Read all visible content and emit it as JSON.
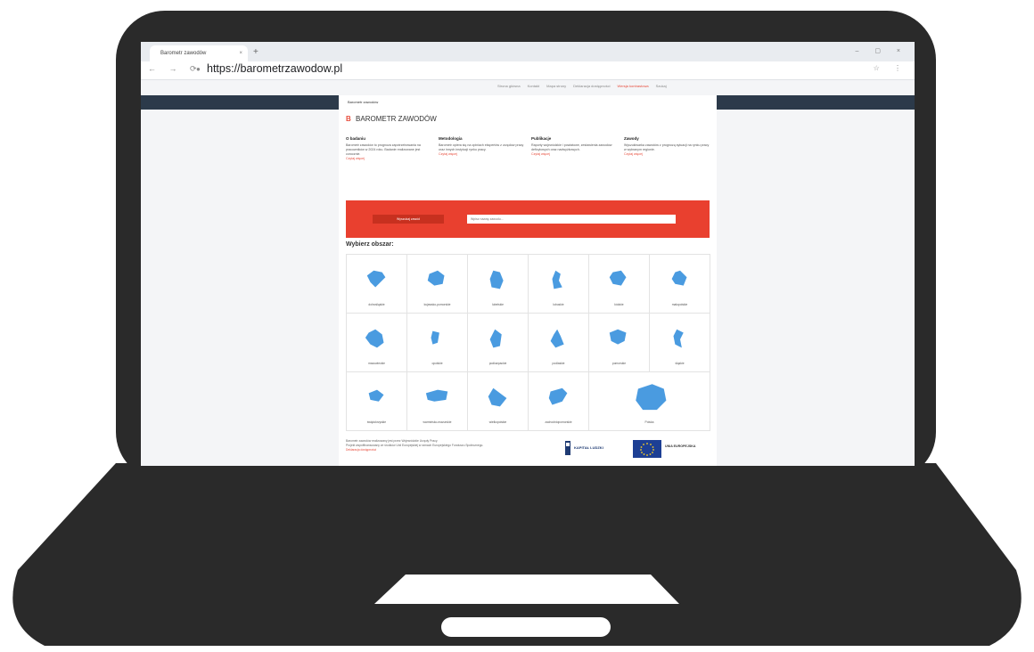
{
  "browser": {
    "tab_title": "Barometr zawodów",
    "tab_close": "×",
    "new_tab": "+",
    "window_controls": "– ▢ ×",
    "nav_buttons": "← → ⟳",
    "url": "https://barometrzawodow.pl",
    "toolbar_icons": "☆ ⋮"
  },
  "site": {
    "top_nav": [
      "Strona główna",
      "Kontakt",
      "Mapa strony",
      "Deklaracja dostępności",
      "Wersja kontrastowa",
      "Szukaj"
    ],
    "page_tab_label": "Barometr zawodów",
    "brand_logo": "B",
    "brand_name": "BAROMETR ZAWODÓW",
    "columns": [
      {
        "title": "O badaniu",
        "text": "Barometr zawodów to prognoza zapotrzebowania na pracowników w 2024 roku. Badanie realizowane jest corocznie.",
        "more": "Czytaj więcej"
      },
      {
        "title": "Metodologia",
        "text": "Barometr opiera się na opiniach ekspertów z urzędów pracy oraz innych instytucji rynku pracy.",
        "more": "Czytaj więcej"
      },
      {
        "title": "Publikacje",
        "text": "Raporty wojewódzkie i powiatowe, zestawienia zawodów deficytowych oraz nadwyżkowych.",
        "more": "Czytaj więcej"
      },
      {
        "title": "Zawody",
        "text": "Wyszukiwarka zawodów z prognozą sytuacji na rynku pracy w wybranym regionie.",
        "more": "Czytaj więcej"
      }
    ],
    "search_button": "Wyszukaj zawód",
    "search_placeholder": "Wpisz nazwę zawodu...",
    "choose_region": "Wybierz obszar:",
    "regions": [
      "dolnośląskie",
      "kujawsko-pomorskie",
      "lubelskie",
      "lubuskie",
      "łódzkie",
      "małopolskie",
      "mazowieckie",
      "opolskie",
      "podkarpackie",
      "podlaskie",
      "pomorskie",
      "śląskie",
      "świętokrzyskie",
      "warmińsko-mazurskie",
      "wielkopolskie",
      "zachodniopomorskie",
      "Polska"
    ],
    "footer_lines": [
      "Barometr zawodów realizowany jest przez Wojewódzkie Urzędy Pracy.",
      "Projekt współfinansowany ze środków Unii Europejskiej w ramach Europejskiego Funduszu Społecznego.",
      "Deklaracja dostępności"
    ],
    "logo_left_text": "KAPITAŁ LUDZKI",
    "logo_right_text": "UNIA EUROPEJSKA"
  },
  "colors": {
    "accent_red": "#e9402f",
    "region_blue": "#4a9be0",
    "dark_band": "#2c3a4a",
    "laptop_body": "#2a2a2a"
  }
}
